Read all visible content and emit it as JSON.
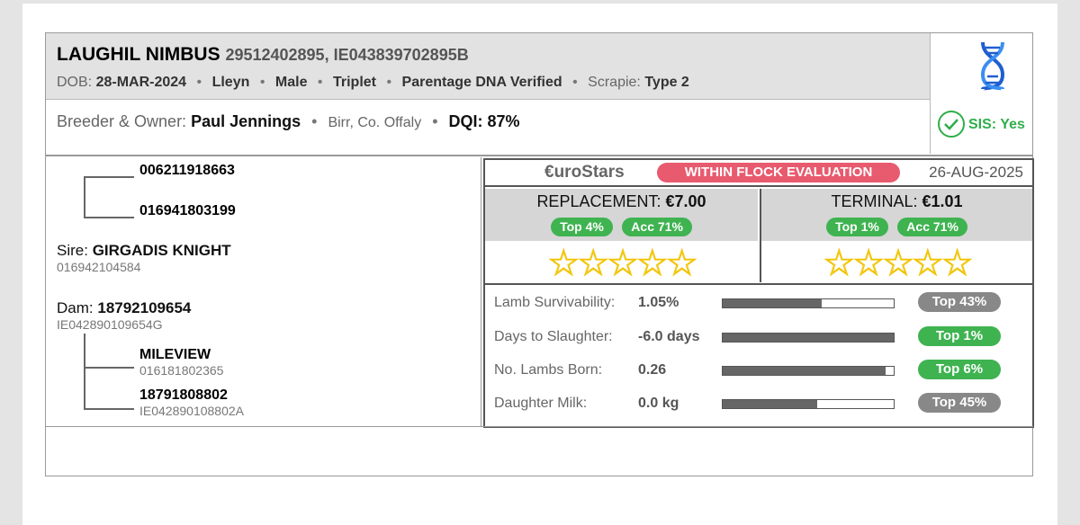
{
  "header": {
    "name": "LAUGHIL NIMBUS",
    "ids": "29512402895, IE043839702895B",
    "dob_label": "DOB:",
    "dob": "28-MAR-2024",
    "breed": "Lleyn",
    "sex": "Male",
    "birth_type": "Triplet",
    "parentage": "Parentage DNA Verified",
    "scrapie_label": "Scrapie:",
    "scrapie": "Type 2",
    "breeder_label": "Breeder & Owner:",
    "owner": "Paul Jennings",
    "location": "Birr, Co. Offaly",
    "dqi": "DQI: 87%",
    "separator": "•"
  },
  "badges": {
    "dna_icon": "dna-helix-icon",
    "sis": "SIS: Yes",
    "sis_icon": "check-circle-icon",
    "sis_color": "#2fae4a"
  },
  "pedigree": {
    "sire_sire": "006211918663",
    "sire_dam": "016941803199",
    "sire_label": "Sire:",
    "sire_name": "GIRGADIS KNIGHT",
    "sire_id": "016942104584",
    "dam_label": "Dam:",
    "dam_name": "18792109654",
    "dam_id": "IE042890109654G",
    "dam_sire_name": "MILEVIEW",
    "dam_sire_id": "016181802365",
    "dam_dam_name": "18791808802",
    "dam_dam_id": "IE042890108802A"
  },
  "eurostars": {
    "logo": "€uroStars",
    "evaluation": "WITHIN FLOCK EVALUATION",
    "evaluation_color": "#e85a6e",
    "date": "26-AUG-2025",
    "replacement": {
      "label": "REPLACEMENT:",
      "value": "€7.00",
      "top": "Top 4%",
      "acc": "Acc 71%",
      "stars": 0
    },
    "terminal": {
      "label": "TERMINAL:",
      "value": "€1.01",
      "top": "Top 1%",
      "acc": "Acc 71%",
      "stars": 0
    },
    "star_glyphs": "☆☆☆☆☆",
    "traits": [
      {
        "label": "Lamb Survivability:",
        "value": "1.05%",
        "fill": 0.58,
        "pill": "Top 43%",
        "pill_color": "#888888"
      },
      {
        "label": "Days to Slaughter:",
        "value": "-6.0 days",
        "fill": 1.0,
        "pill": "Top 1%",
        "pill_color": "#3fb350"
      },
      {
        "label": "No. Lambs Born:",
        "value": "0.26",
        "fill": 0.95,
        "pill": "Top 6%",
        "pill_color": "#3fb350"
      },
      {
        "label": "Daughter Milk:",
        "value": "0.0 kg",
        "fill": 0.55,
        "pill": "Top 45%",
        "pill_color": "#888888"
      }
    ]
  }
}
